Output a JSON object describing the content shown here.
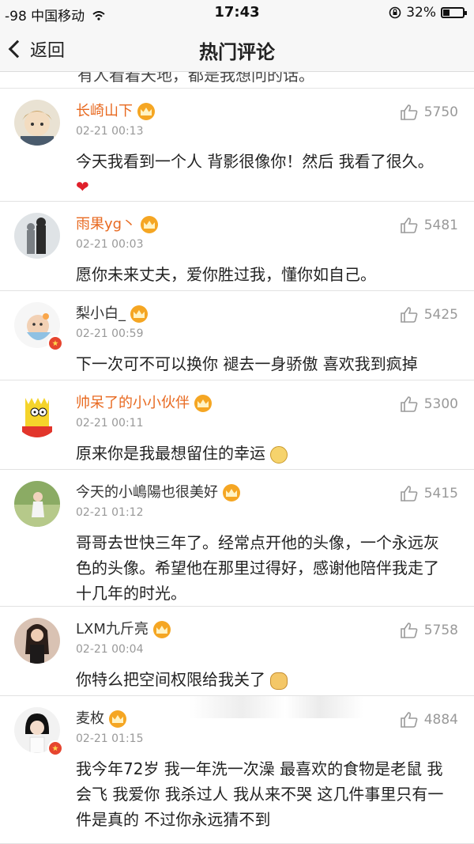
{
  "status_bar": {
    "carrier": "-98 中国移动",
    "time": "17:43",
    "battery": "32%",
    "battery_level": 0.32
  },
  "nav": {
    "back_label": "返回",
    "title": "热门评论"
  },
  "partial_text": "有人看着天地，都是我想问的话。",
  "comments": [
    {
      "user": "长崎山下",
      "time": "02-21 00:13",
      "likes": "5750",
      "text": "今天我看到一个人 背影很像你！然后 我看了很久。",
      "emoji": "heart"
    },
    {
      "user": "雨果yg丶",
      "time": "02-21 00:03",
      "likes": "5481",
      "text": "愿你未来丈夫，爱你胜过我，懂你如自己。",
      "emoji": ""
    },
    {
      "user": "梨小白_",
      "time": "02-21 00:59",
      "likes": "5425",
      "text": "下一次可不可以换你 褪去一身骄傲 喜欢我到疯掉",
      "emoji": ""
    },
    {
      "user": "帅呆了的小小伙伴",
      "time": "02-21 00:11",
      "likes": "5300",
      "text": "原来你是我最想留住的幸运",
      "emoji": "face"
    },
    {
      "user": "今天的小嶋陽也很美好",
      "time": "02-21 01:12",
      "likes": "5415",
      "text": "哥哥去世快三年了。经常点开他的头像，一个永远灰色的头像。希望他在那里过得好，感谢他陪伴我走了十几年的时光。",
      "emoji": ""
    },
    {
      "user": "LXM九斤亮",
      "time": "02-21 00:04",
      "likes": "5758",
      "text": "你特么把空间权限给我关了",
      "emoji": "dog"
    },
    {
      "user": "麦枚",
      "time": "02-21 01:15",
      "likes": "4884",
      "text": "我今年72岁 我一年洗一次澡 最喜欢的食物是老鼠 我会飞 我爱你 我杀过人 我从来不哭 这几件事里只有一件是真的 不过你永远猜不到",
      "emoji": ""
    }
  ],
  "heart_char": "❤"
}
